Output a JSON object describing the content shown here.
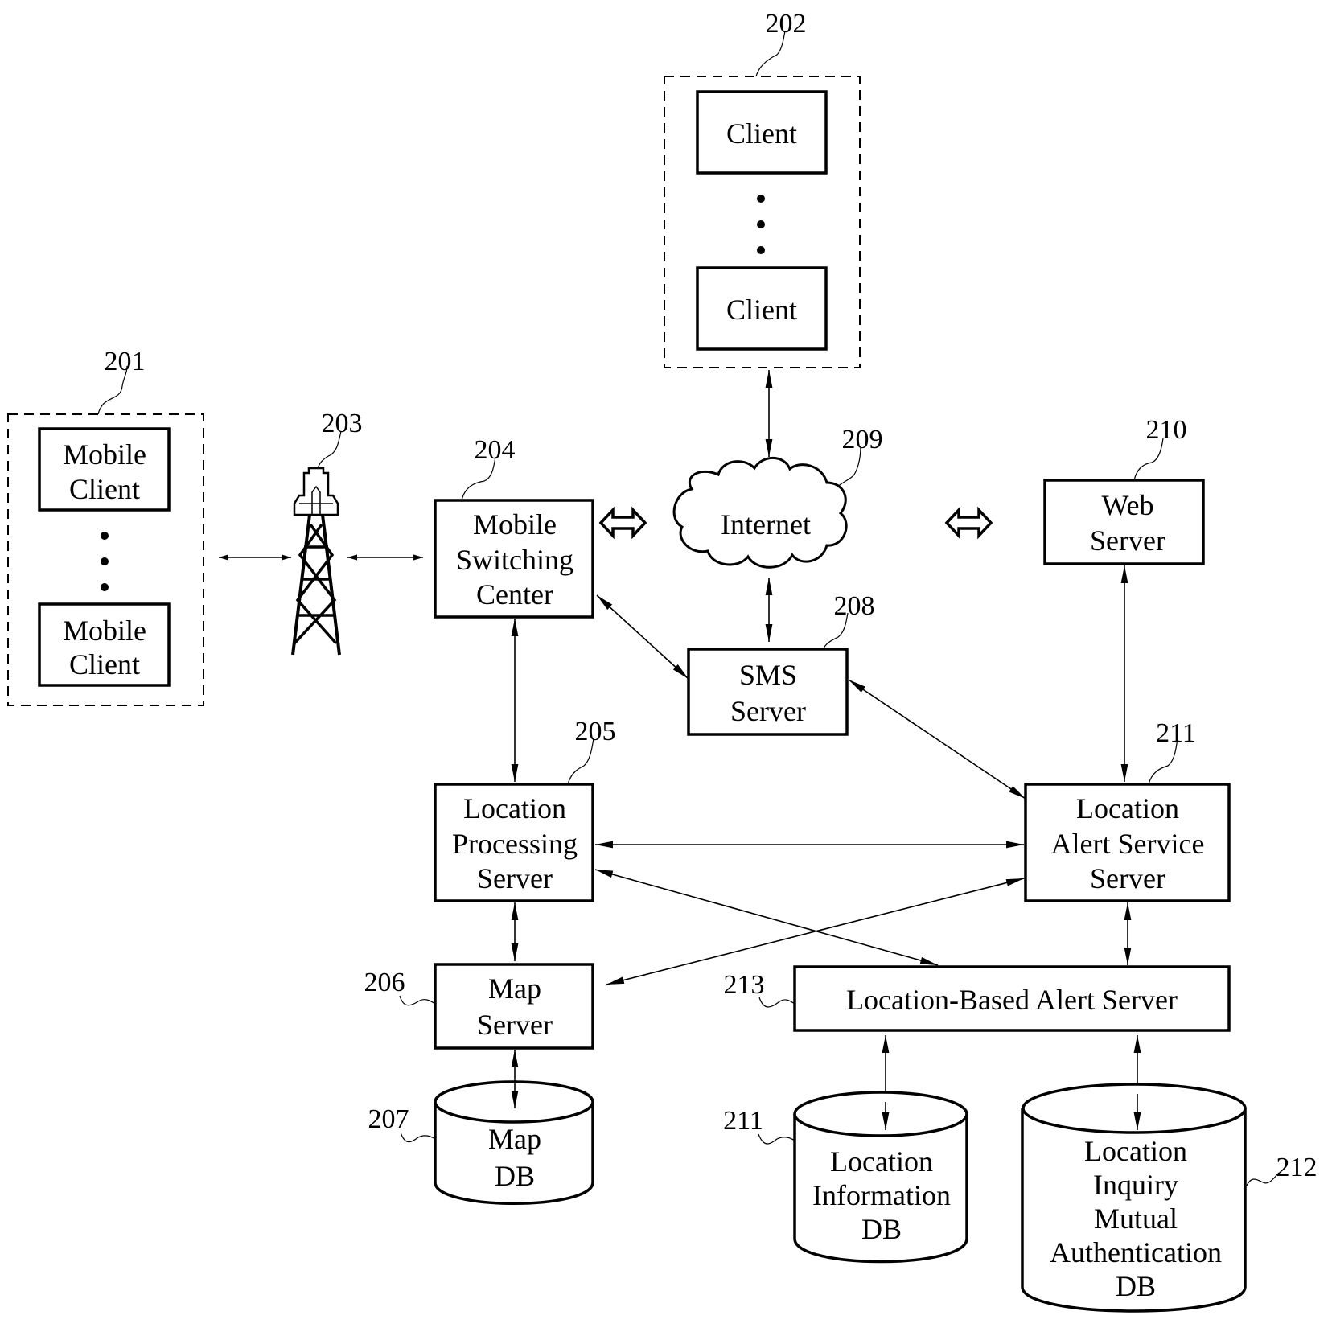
{
  "diagram": {
    "refs": {
      "mobile_group": "201",
      "client_group": "202",
      "tower": "203",
      "msc": "204",
      "lps": "205",
      "map_server": "206",
      "map_db": "207",
      "sms": "208",
      "internet": "209",
      "web": "210",
      "lass": "211",
      "lbas": "213",
      "loc_info_db": "211",
      "auth_db": "212"
    },
    "mobile_clients": [
      {
        "line1": "Mobile",
        "line2": "Client"
      },
      {
        "line1": "Mobile",
        "line2": "Client"
      }
    ],
    "clients": [
      "Client",
      "Client"
    ],
    "msc": [
      "Mobile",
      "Switching",
      "Center"
    ],
    "internet": "Internet",
    "web": [
      "Web",
      "Server"
    ],
    "sms": [
      "SMS",
      "Server"
    ],
    "lps": [
      "Location",
      "Processing",
      "Server"
    ],
    "lass": [
      "Location",
      "Alert Service",
      "Server"
    ],
    "map_server": [
      "Map",
      "Server"
    ],
    "lbas": "Location-Based Alert Server",
    "map_db": [
      "Map",
      "DB"
    ],
    "loc_info_db": [
      "Location",
      "Information",
      "DB"
    ],
    "auth_db": [
      "Location",
      "Inquiry",
      "Mutual",
      "Authentication",
      "DB"
    ]
  }
}
